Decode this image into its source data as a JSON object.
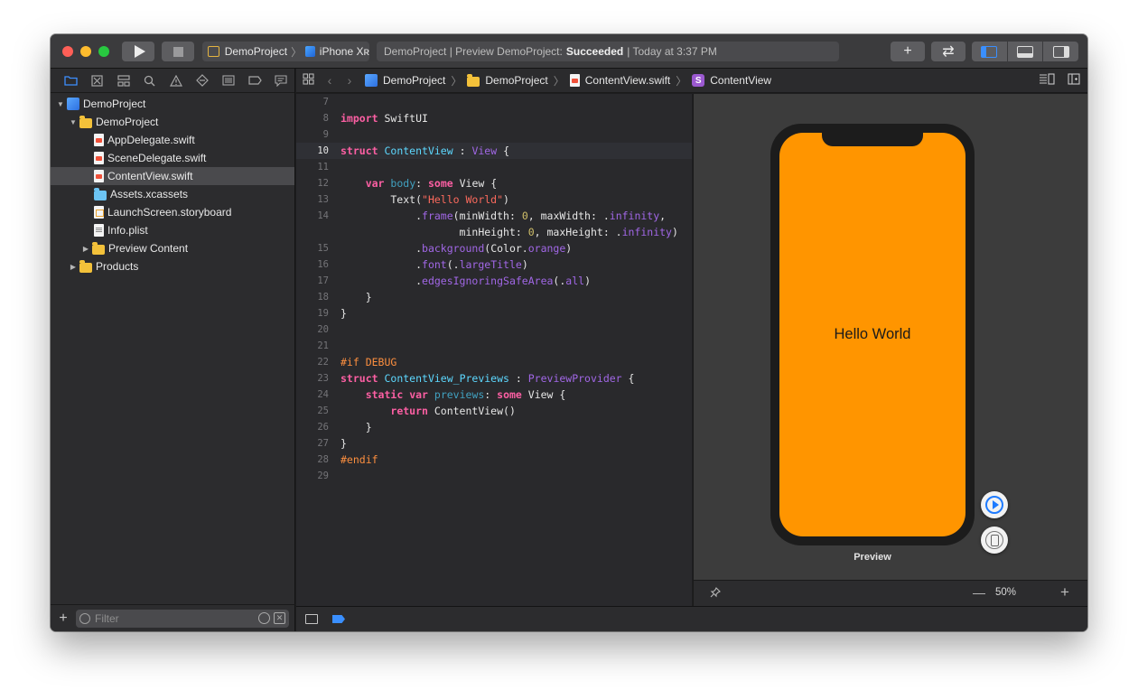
{
  "toolbar": {
    "scheme": "DemoProject",
    "device": "iPhone Xʀ",
    "status_prefix": "DemoProject | Preview DemoProject:",
    "status_result": "Succeeded",
    "status_time": "| Today at 3:37 PM",
    "add_label": "+",
    "swap_label": "⇄"
  },
  "navigator": {
    "tree": [
      {
        "label": "DemoProject",
        "icon": "project-icon"
      },
      {
        "label": "DemoProject",
        "icon": "folder-icon"
      },
      {
        "label": "AppDelegate.swift",
        "icon": "swift-file-icon"
      },
      {
        "label": "SceneDelegate.swift",
        "icon": "swift-file-icon"
      },
      {
        "label": "ContentView.swift",
        "icon": "swift-file-icon"
      },
      {
        "label": "Assets.xcassets",
        "icon": "assets-folder-icon"
      },
      {
        "label": "LaunchScreen.storyboard",
        "icon": "storyboard-file-icon"
      },
      {
        "label": "Info.plist",
        "icon": "plist-file-icon"
      },
      {
        "label": "Preview Content",
        "icon": "folder-icon"
      },
      {
        "label": "Products",
        "icon": "folder-icon"
      }
    ],
    "filter_placeholder": "Filter",
    "add_label": "+"
  },
  "jumpbar": {
    "crumbs": [
      "DemoProject",
      "DemoProject",
      "ContentView.swift",
      "ContentView"
    ],
    "symbol_badge": "S"
  },
  "editor": {
    "current_line": 10,
    "lines": [
      {
        "n": "7"
      },
      {
        "n": "8"
      },
      {
        "n": "9"
      },
      {
        "n": "10"
      },
      {
        "n": "11"
      },
      {
        "n": "12"
      },
      {
        "n": "13"
      },
      {
        "n": "14"
      },
      {
        "n": ""
      },
      {
        "n": "15"
      },
      {
        "n": "16"
      },
      {
        "n": "17"
      },
      {
        "n": "18"
      },
      {
        "n": "19"
      },
      {
        "n": "20"
      },
      {
        "n": "21"
      },
      {
        "n": "22"
      },
      {
        "n": "23"
      },
      {
        "n": "24"
      },
      {
        "n": "25"
      },
      {
        "n": "26"
      },
      {
        "n": "27"
      },
      {
        "n": "28"
      },
      {
        "n": "29"
      }
    ]
  },
  "canvas": {
    "preview_text": "Hello World",
    "preview_label": "Preview",
    "screen_color": "#ff9500",
    "zoom": "50%",
    "zoom_minus": "—",
    "zoom_plus": "+"
  }
}
